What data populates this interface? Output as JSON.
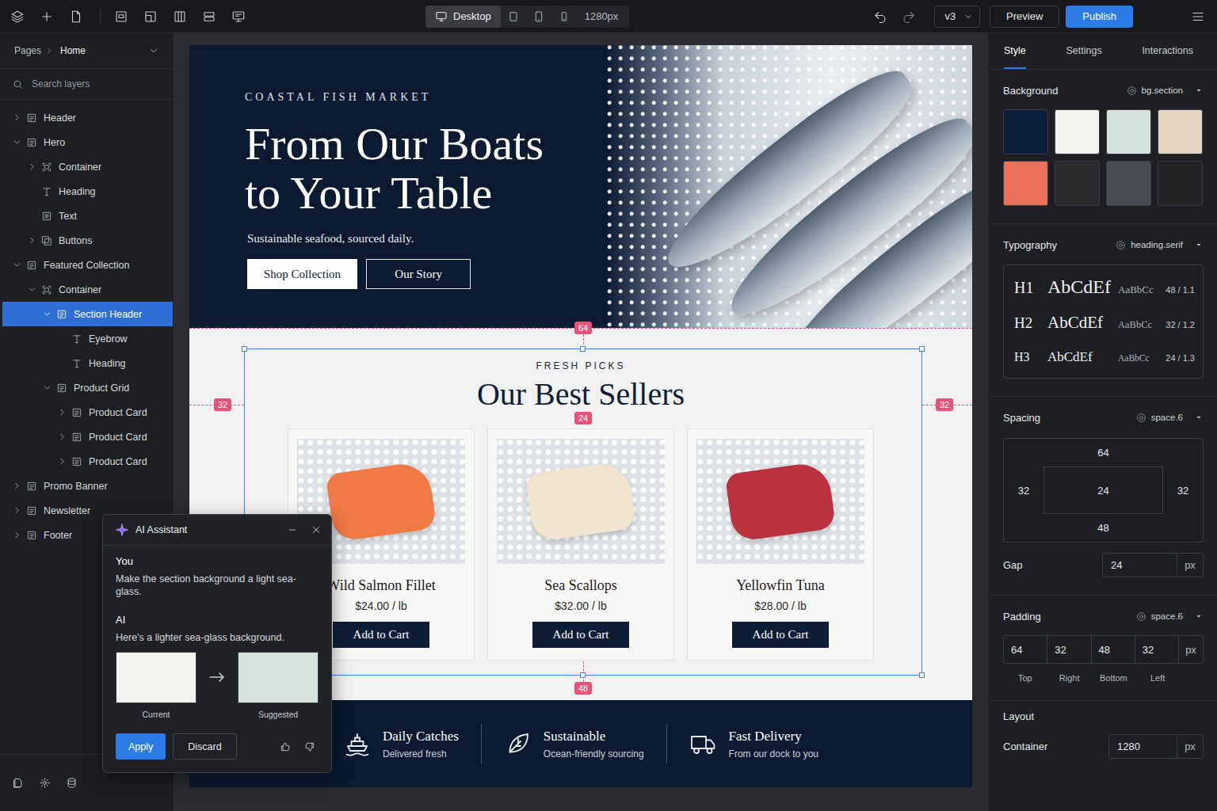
{
  "toolbar": {
    "device_label": "Desktop",
    "devices": [
      {
        "kind": "desktop",
        "selected": true
      },
      {
        "kind": "tablet-landscape",
        "selected": false
      },
      {
        "kind": "tablet",
        "selected": false
      },
      {
        "kind": "phone",
        "selected": false
      }
    ],
    "width": "1280px",
    "version": "v3",
    "preview": "Preview",
    "publish": "Publish"
  },
  "sidebar": {
    "breadcrumb": "Pages",
    "page": "Home",
    "search_placeholder": "Search layers",
    "layers": [
      {
        "label": "Header",
        "depth": 0,
        "kind": "section",
        "has_children": true,
        "expanded": false,
        "selected": false
      },
      {
        "label": "Hero",
        "depth": 0,
        "kind": "section",
        "has_children": true,
        "expanded": true,
        "selected": false
      },
      {
        "label": "Container",
        "depth": 1,
        "kind": "frame",
        "has_children": true,
        "expanded": false,
        "selected": false
      },
      {
        "label": "Heading",
        "depth": 1,
        "kind": "text",
        "has_children": false,
        "expanded": false,
        "selected": false
      },
      {
        "label": "Text",
        "depth": 1,
        "kind": "paragraph",
        "has_children": false,
        "expanded": false,
        "selected": false
      },
      {
        "label": "Buttons",
        "depth": 1,
        "kind": "group",
        "has_children": true,
        "expanded": false,
        "selected": false
      },
      {
        "label": "Featured Collection",
        "depth": 0,
        "kind": "section",
        "has_children": true,
        "expanded": true,
        "selected": false
      },
      {
        "label": "Container",
        "depth": 1,
        "kind": "frame",
        "has_children": true,
        "expanded": true,
        "selected": false
      },
      {
        "label": "Section Header",
        "depth": 2,
        "kind": "section",
        "has_children": true,
        "expanded": true,
        "selected": true
      },
      {
        "label": "Eyebrow",
        "depth": 3,
        "kind": "text",
        "has_children": false,
        "expanded": false,
        "selected": false
      },
      {
        "label": "Heading",
        "depth": 3,
        "kind": "text",
        "has_children": false,
        "expanded": false,
        "selected": false
      },
      {
        "label": "Product Grid",
        "depth": 2,
        "kind": "section",
        "has_children": true,
        "expanded": true,
        "selected": false
      },
      {
        "label": "Product Card",
        "depth": 3,
        "kind": "section",
        "has_children": true,
        "expanded": false,
        "selected": false
      },
      {
        "label": "Product Card",
        "depth": 3,
        "kind": "section",
        "has_children": true,
        "expanded": false,
        "selected": false
      },
      {
        "label": "Product Card",
        "depth": 3,
        "kind": "section",
        "has_children": true,
        "expanded": false,
        "selected": false
      },
      {
        "label": "Promo Banner",
        "depth": 0,
        "kind": "section",
        "has_children": true,
        "expanded": false,
        "selected": false
      },
      {
        "label": "Newsletter",
        "depth": 0,
        "kind": "section",
        "has_children": true,
        "expanded": false,
        "selected": false
      },
      {
        "label": "Footer",
        "depth": 0,
        "kind": "section",
        "has_children": true,
        "expanded": false,
        "selected": false
      }
    ]
  },
  "page": {
    "hero": {
      "eyebrow": "COASTAL FISH MARKET",
      "heading_lines": [
        "From Our Boats",
        "to Your Table"
      ],
      "subtitle": "Sustainable seafood, sourced daily.",
      "buttons": [
        {
          "label": "Shop Collection",
          "kind": "primary"
        },
        {
          "label": "Our Story",
          "kind": "outline"
        }
      ]
    },
    "featured": {
      "eyebrow": "FRESH PICKS",
      "heading": "Our Best Sellers",
      "products": [
        {
          "name": "Wild Salmon Fillet",
          "price": "$24.00 / lb",
          "button": "Add to Cart",
          "color": "#ef7a45"
        },
        {
          "name": "Sea Scallops",
          "price": "$32.00 / lb",
          "button": "Add to Cart",
          "color": "#f0e4cf"
        },
        {
          "name": "Yellowfin Tuna",
          "price": "$28.00 / lb",
          "button": "Add to Cart",
          "color": "#b9323e"
        }
      ]
    },
    "features": [
      {
        "kind": "boat",
        "title": "Daily Catches",
        "text": "Delivered fresh"
      },
      {
        "kind": "leaf",
        "title": "Sustainable",
        "text": "Ocean-friendly sourcing"
      },
      {
        "kind": "truck",
        "title": "Fast Delivery",
        "text": "From our dock to you"
      }
    ]
  },
  "overlay": {
    "top": "64",
    "left": "32",
    "right": "32",
    "gap": "24",
    "bottom": "48"
  },
  "inspector": {
    "tabs": [
      {
        "label": "Style",
        "selected": true
      },
      {
        "label": "Settings",
        "selected": false
      },
      {
        "label": "Interactions",
        "selected": false
      }
    ],
    "background": {
      "label": "Background",
      "token": "bg.section",
      "swatches": [
        {
          "color": "#0d1f3a"
        },
        {
          "color": "#f3f3ef"
        },
        {
          "color": "#d5e2dc"
        },
        {
          "color": "#e3d5c0"
        },
        {
          "color": "#e8735a"
        },
        {
          "color": "#2a2a2c"
        },
        {
          "color": "#474c55"
        },
        {
          "color": "#222324"
        }
      ]
    },
    "typography": {
      "label": "Typography",
      "token": "heading.serif",
      "rows": [
        {
          "tag": "H1",
          "sample": "AbCdEf",
          "small": "AaBbCc",
          "metric": "48 / 1.1"
        },
        {
          "tag": "H2",
          "sample": "AbCdEf",
          "small": "AaBbCc",
          "metric": "32 / 1.2"
        },
        {
          "tag": "H3",
          "sample": "AbCdEf",
          "small": "AaBbCc",
          "metric": "24 / 1.3"
        }
      ]
    },
    "spacing": {
      "label": "Spacing",
      "token": "space.6",
      "top": "64",
      "right": "32",
      "bottom": "48",
      "left": "32",
      "center": "24"
    },
    "gap": {
      "label": "Gap",
      "value": "24",
      "unit": "px"
    },
    "padding": {
      "label": "Padding",
      "token": "space.6",
      "unit": "px",
      "fields": [
        {
          "value": "64",
          "label": "Top"
        },
        {
          "value": "32",
          "label": "Right"
        },
        {
          "value": "48",
          "label": "Bottom"
        },
        {
          "value": "32",
          "label": "Left"
        }
      ]
    },
    "layout": {
      "label": "Layout",
      "container_label": "Container",
      "value": "1280",
      "unit": "px"
    }
  },
  "assistant": {
    "title": "AI Assistant",
    "user_label": "You",
    "user_message": "Make the section background a light sea-glass.",
    "ai_label": "AI",
    "ai_message": "Here's a lighter sea-glass background.",
    "current": {
      "label": "Current",
      "color": "#f3f3ef"
    },
    "suggested": {
      "label": "Suggested",
      "color": "#d6e3dd"
    },
    "apply": "Apply",
    "discard": "Discard"
  }
}
